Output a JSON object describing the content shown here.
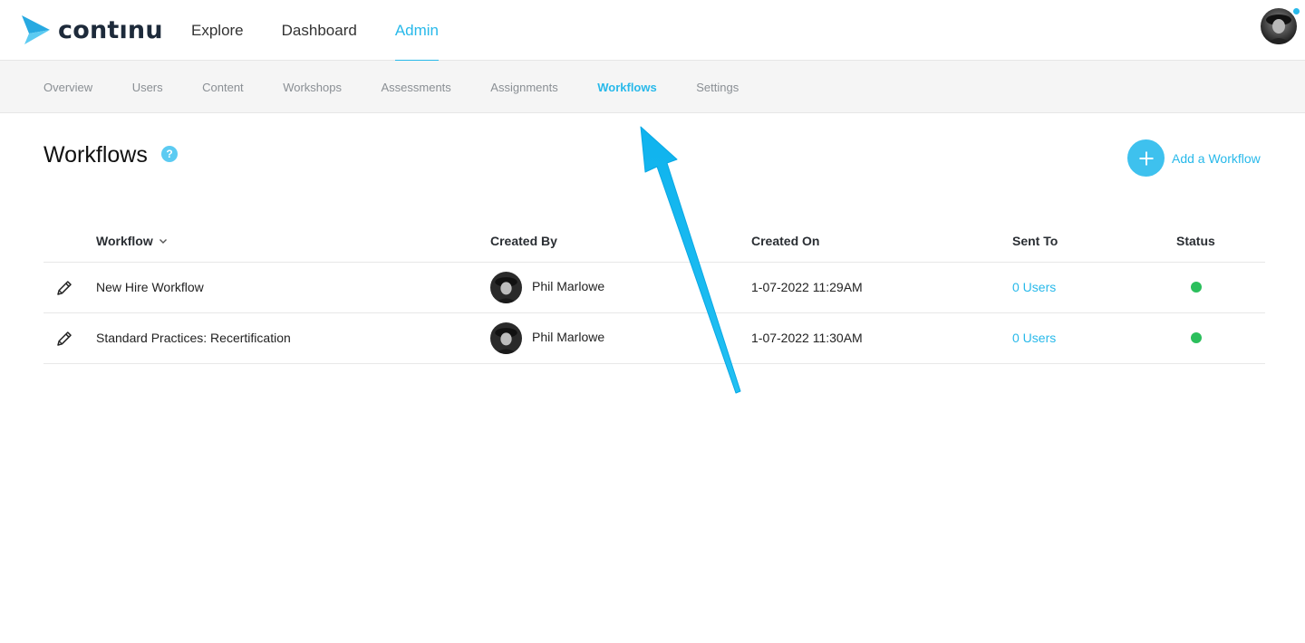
{
  "app": {
    "logo_text": "contınu"
  },
  "main_nav": [
    {
      "label": "Explore",
      "active": false
    },
    {
      "label": "Dashboard",
      "active": false
    },
    {
      "label": "Admin",
      "active": true
    }
  ],
  "sub_nav": [
    {
      "label": "Overview",
      "active": false
    },
    {
      "label": "Users",
      "active": false
    },
    {
      "label": "Content",
      "active": false
    },
    {
      "label": "Workshops",
      "active": false
    },
    {
      "label": "Assessments",
      "active": false
    },
    {
      "label": "Assignments",
      "active": false
    },
    {
      "label": "Workflows",
      "active": true
    },
    {
      "label": "Settings",
      "active": false
    }
  ],
  "page": {
    "title": "Workflows",
    "help_glyph": "?",
    "add_label": "Add a Workflow"
  },
  "table": {
    "columns": [
      "Workflow",
      "Created By",
      "Created On",
      "Sent To",
      "Status"
    ],
    "rows": [
      {
        "name": "New Hire Workflow",
        "created_by": "Phil Marlowe",
        "created_on": "1-07-2022 11:29AM",
        "sent_to": "0 Users",
        "status": "active"
      },
      {
        "name": "Standard Practices: Recertification",
        "created_by": "Phil Marlowe",
        "created_on": "1-07-2022 11:30AM",
        "sent_to": "0 Users",
        "status": "active"
      }
    ]
  },
  "colors": {
    "accent": "#28b9ea",
    "status_active": "#2bbf5c",
    "annotation_arrow": "#1ab8ee"
  },
  "icons": {
    "logo": "continu-arrow-icon",
    "help": "help-icon",
    "add": "plus-icon",
    "sort": "chevron-down-icon",
    "edit": "pencil-icon",
    "status": "status-dot"
  }
}
